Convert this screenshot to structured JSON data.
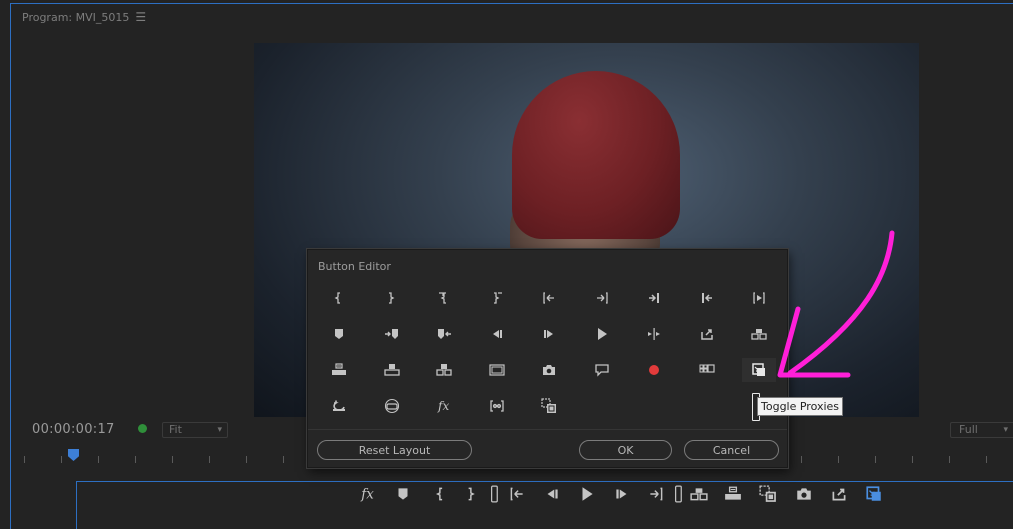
{
  "panel": {
    "title": "Program: MVI_5015",
    "menu_icon": "hamburger-icon"
  },
  "monitor": {
    "timecode": "00:00:00:17",
    "fit_select": {
      "value": "Fit"
    },
    "quality_select": {
      "value": "Full"
    }
  },
  "dialog": {
    "title": "Button Editor",
    "buttons": [
      [
        "mark-in-icon",
        "mark-out-icon",
        "clear-in-icon",
        "clear-out-icon",
        "go-to-in-icon",
        "go-to-out-icon",
        "go-to-next-edit-icon",
        "go-to-previous-edit-icon",
        "play-in-to-out-icon"
      ],
      [
        "add-marker-icon",
        "go-to-next-marker-icon",
        "go-to-previous-marker-icon",
        "step-back-icon",
        "step-forward-icon",
        "play-icon",
        "play-around-icon",
        "export-frame-icon",
        "insert-icon"
      ],
      [
        "overwrite-icon",
        "lift-icon",
        "extract-icon",
        "safe-margins-icon",
        "camera-icon",
        "closed-captions-icon",
        "record-voiceover-icon",
        "multi-camera-icon",
        "toggle-proxies-icon"
      ],
      [
        "loop-icon",
        "vr-video-icon",
        "fx-icon",
        "trim-monitor-icon",
        "comparison-view-icon"
      ]
    ],
    "reset_label": "Reset Layout",
    "ok_label": "OK",
    "cancel_label": "Cancel"
  },
  "tooltip": {
    "text": "Toggle Proxies"
  },
  "transport": {
    "buttons": [
      "fx-icon",
      "add-marker-icon",
      "mark-in-icon",
      "mark-out-icon",
      "bracket-separator-icon",
      "go-to-in-icon",
      "step-back-icon",
      "play-icon",
      "step-forward-icon",
      "go-to-out-icon",
      "bracket-separator-icon",
      "insert-icon",
      "overwrite-icon",
      "comparison-view-icon",
      "camera-icon",
      "export-frame-icon",
      "toggle-proxies-icon"
    ]
  },
  "colors": {
    "accent": "#2d6fc2",
    "record": "#e23b3b",
    "annotation": "#ff1fd8"
  }
}
